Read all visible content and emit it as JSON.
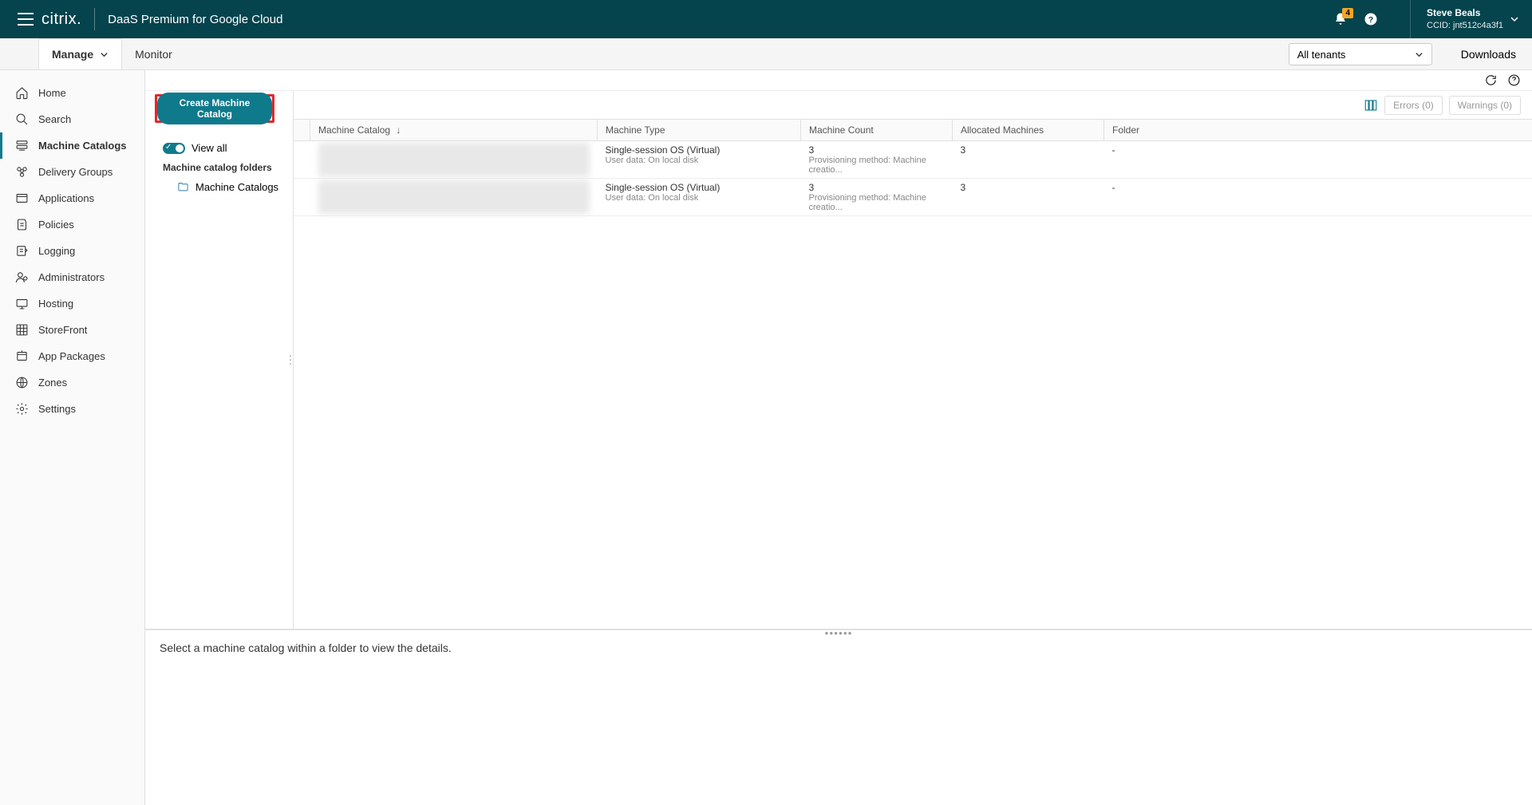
{
  "header": {
    "logo_text": "citrix.",
    "product_name": "DaaS Premium for Google Cloud",
    "notification_badge": "4",
    "user_name": "Steve Beals",
    "user_ccid": "CCID: jnt512c4a3f1"
  },
  "subnav": {
    "manage": "Manage",
    "monitor": "Monitor",
    "tenant_selected": "All tenants",
    "downloads": "Downloads"
  },
  "sidebar": {
    "items": [
      {
        "label": "Home"
      },
      {
        "label": "Search"
      },
      {
        "label": "Machine Catalogs"
      },
      {
        "label": "Delivery Groups"
      },
      {
        "label": "Applications"
      },
      {
        "label": "Policies"
      },
      {
        "label": "Logging"
      },
      {
        "label": "Administrators"
      },
      {
        "label": "Hosting"
      },
      {
        "label": "StoreFront"
      },
      {
        "label": "App Packages"
      },
      {
        "label": "Zones"
      },
      {
        "label": "Settings"
      }
    ]
  },
  "folder_panel": {
    "create_btn": "Create Machine Catalog",
    "view_all": "View all",
    "folders_header": "Machine catalog folders",
    "folder_item": "Machine Catalogs"
  },
  "table": {
    "errors_btn": "Errors (0)",
    "warnings_btn": "Warnings (0)",
    "columns": {
      "machine_catalog": "Machine Catalog",
      "machine_type": "Machine Type",
      "machine_count": "Machine Count",
      "allocated_machines": "Allocated Machines",
      "folder": "Folder"
    },
    "rows": [
      {
        "type_main": "Single-session OS (Virtual)",
        "type_sub": "User data: On local disk",
        "count_main": "3",
        "count_sub": "Provisioning method: Machine creatio...",
        "allocated": "3",
        "folder": "-"
      },
      {
        "type_main": "Single-session OS (Virtual)",
        "type_sub": "User data: On local disk",
        "count_main": "3",
        "count_sub": "Provisioning method: Machine creatio...",
        "allocated": "3",
        "folder": "-"
      }
    ]
  },
  "detail": {
    "empty_text": "Select a machine catalog within a folder to view the details."
  }
}
